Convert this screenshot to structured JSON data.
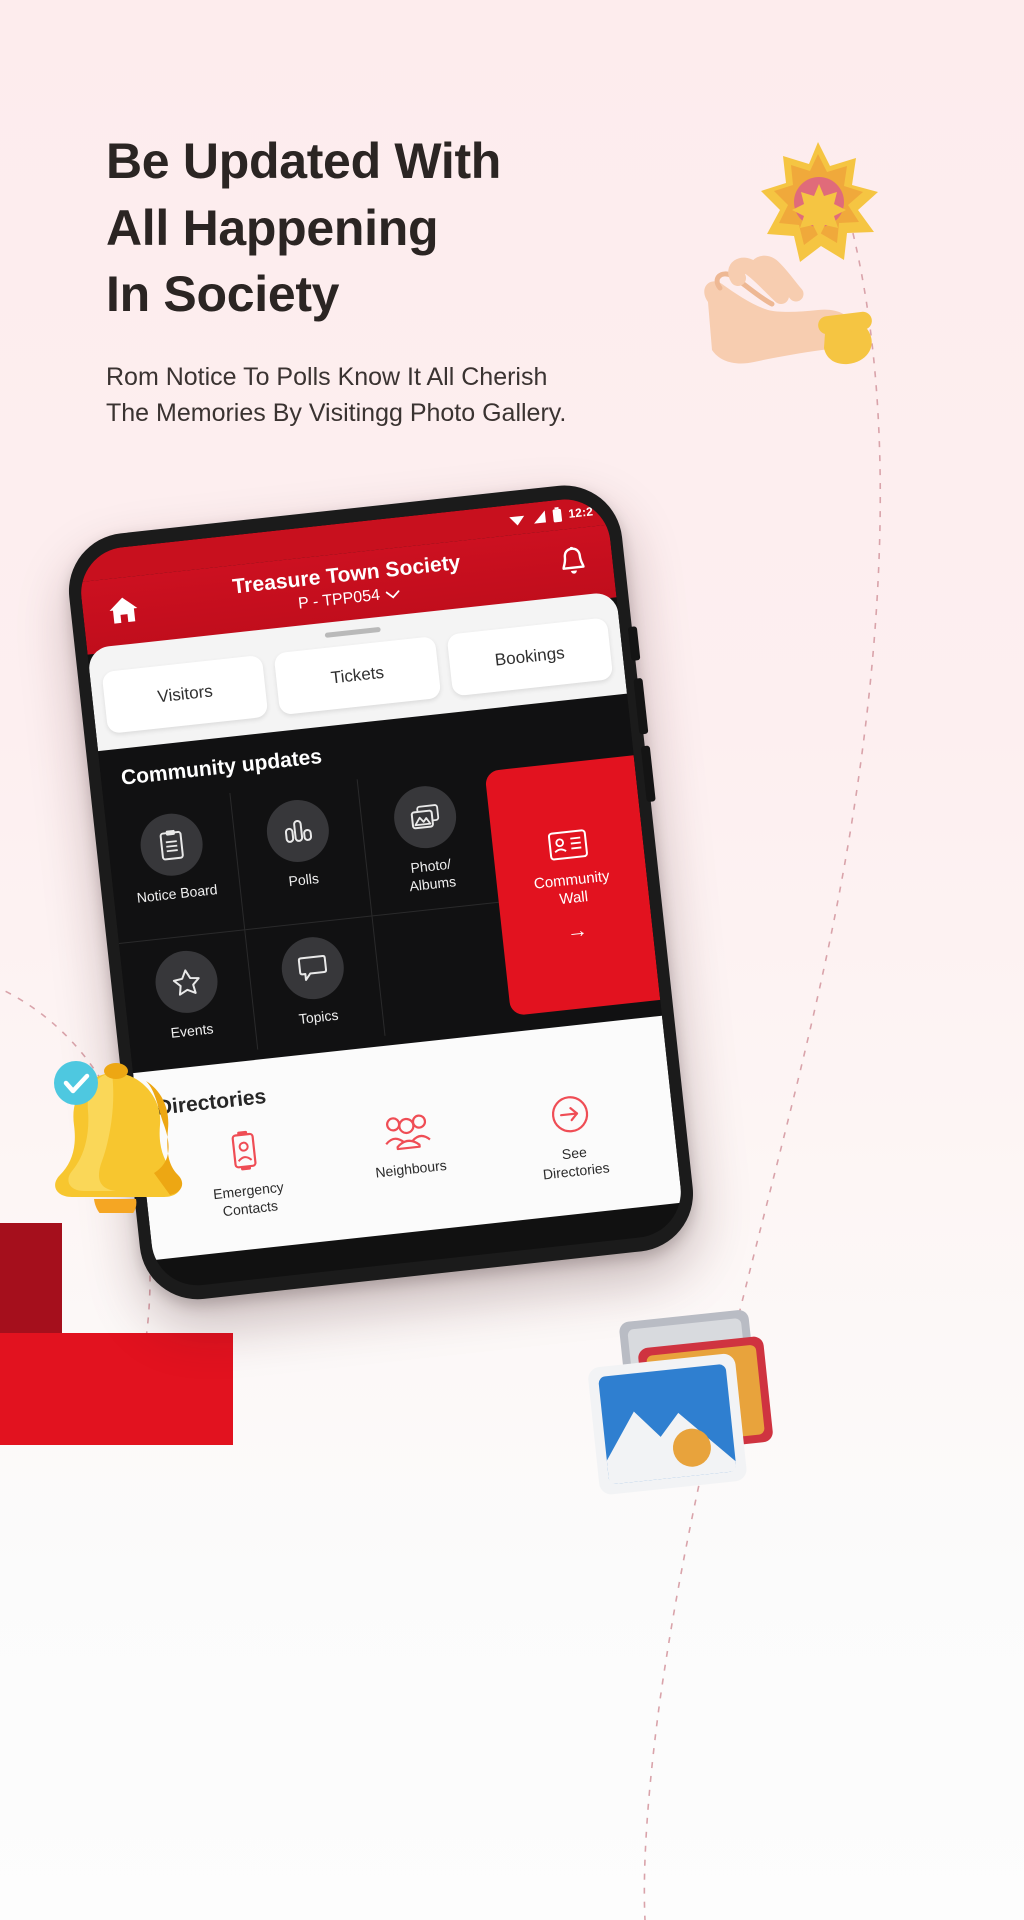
{
  "theme": {
    "background": "#fdeeee",
    "brand_red": "#e2121f",
    "dark_red": "#a50f1c",
    "header_red": "#c8101e",
    "dark_panel": "#111112",
    "text_dark": "#2b2523"
  },
  "hero": {
    "headline": "Be Updated With\nAll Happening\nIn Society",
    "subhead": "Rom Notice To Polls Know It All Cherish\nThe Memories By Visitingg Photo Gallery."
  },
  "phone": {
    "status_bar": {
      "time": "12:2",
      "icons": [
        "wifi-icon",
        "signal-icon",
        "battery-icon"
      ]
    },
    "header": {
      "home_icon": "home-icon",
      "title": "Treasure Town Society",
      "subtitle": "P - TPP054",
      "chevron": "chevron-down-icon",
      "bell_icon": "bell-icon"
    },
    "tabs": [
      {
        "label": "Visitors"
      },
      {
        "label": "Tickets"
      },
      {
        "label": "Bookings"
      }
    ],
    "community": {
      "title": "Community updates",
      "items": [
        {
          "label": "Notice Board",
          "icon": "clipboard-icon"
        },
        {
          "label": "Polls",
          "icon": "bar-chart-icon"
        },
        {
          "label": "Photo/\nAlbums",
          "icon": "photo-stack-icon"
        },
        {
          "label": "Events",
          "icon": "star-icon"
        },
        {
          "label": "Topics",
          "icon": "speech-bubble-icon"
        }
      ],
      "wall": {
        "label": "Community\nWall",
        "icon": "id-card-icon",
        "arrow": "→"
      }
    },
    "directories": {
      "title": "Directories",
      "items": [
        {
          "label": "Emergency\nContacts",
          "icon": "contact-card-icon"
        },
        {
          "label": "Neighbours",
          "icon": "people-group-icon"
        },
        {
          "label": "See\nDirectories",
          "icon": "arrow-circle-right-icon"
        }
      ]
    }
  }
}
